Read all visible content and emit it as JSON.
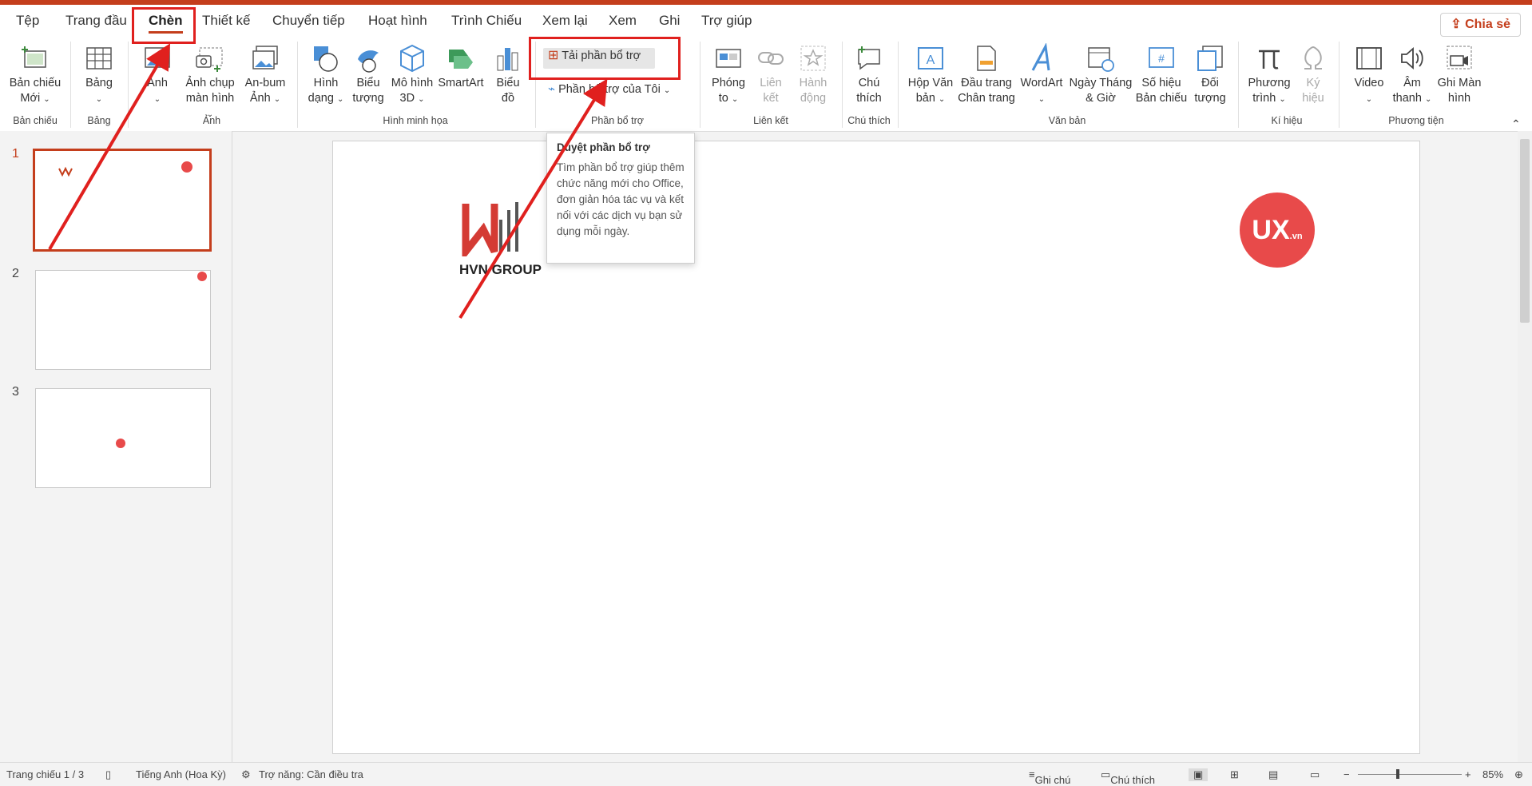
{
  "menu": {
    "tabs": [
      "Tệp",
      "Trang đầu",
      "Chèn",
      "Thiết kế",
      "Chuyển tiếp",
      "Hoạt hình",
      "Trình Chiếu",
      "Xem lại",
      "Xem",
      "Ghi",
      "Trợ giúp"
    ],
    "active": "Chèn",
    "share": "Chia sẻ"
  },
  "ribbon": {
    "new_slide": "Bản chiếu Mới",
    "table": "Bảng",
    "picture": "Ảnh",
    "screenshot": "Ảnh chụp màn hình",
    "album": "An-bum Ảnh",
    "shapes": "Hình dạng",
    "icons": "Biểu tượng",
    "models3d": "Mô hình 3D",
    "smartart": "SmartArt",
    "chart": "Biểu đồ",
    "get_addins": "Tải phần bổ trợ",
    "my_addins": "Phần bổ trợ của Tôi",
    "zoom": "Phóng to",
    "link": "Liên kết",
    "action": "Hành động",
    "comment": "Chú thích",
    "textbox": "Hộp Văn bản",
    "header_footer": "Đầu trang Chân trang",
    "wordart": "WordArt",
    "datetime": "Ngày Tháng & Giờ",
    "slide_number": "Số hiệu Bản chiếu",
    "object": "Đối tượng",
    "equation": "Phương trình",
    "symbol": "Ký hiệu",
    "video": "Video",
    "audio": "Âm thanh",
    "screen_recording": "Ghi Màn hình",
    "groups": {
      "slides": "Bản chiếu",
      "tables": "Bảng",
      "images": "Ảnh",
      "illustrations": "Hình minh họa",
      "addins": "Phần bổ trợ",
      "links": "Liên kết",
      "comments": "Chú thích",
      "text": "Văn bản",
      "symbols": "Kí hiệu",
      "media": "Phương tiện"
    }
  },
  "tooltip": {
    "title": "Duyệt phần bổ trợ",
    "body": "Tìm phần bổ trợ giúp thêm chức năng mới cho Office, đơn giản hóa tác vụ và kết nối với các dịch vụ bạn sử dụng mỗi ngày."
  },
  "thumbnails": [
    "1",
    "2",
    "3"
  ],
  "slide": {
    "hvn_text": "HVN GROUP",
    "ux_text": "UX",
    "ux_suffix": ".vn"
  },
  "status": {
    "slide_info": "Trang chiếu 1 / 3",
    "language": "Tiếng Anh (Hoa Kỳ)",
    "accessibility": "Trợ năng: Cần điều tra",
    "notes": "Ghi chú",
    "comments": "Chú thích",
    "zoom": "85%"
  },
  "colors": {
    "accent": "#c43e1c",
    "highlight": "#e0201e",
    "ux_logo": "#e84a4a"
  }
}
